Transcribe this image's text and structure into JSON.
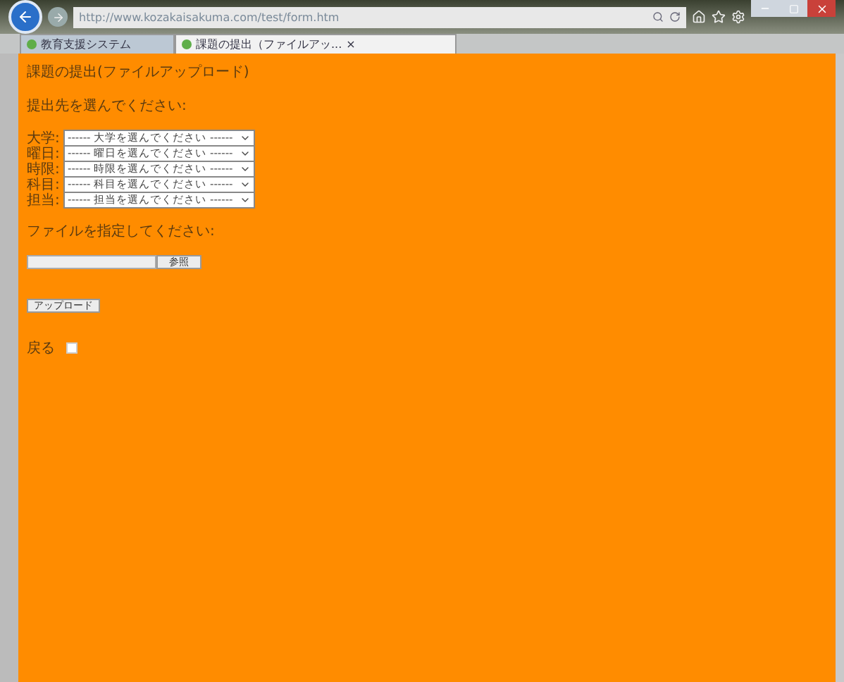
{
  "browser": {
    "url": "http://www.kozakaisakuma.com/test/form.htm",
    "tabs": [
      {
        "label": "教育支援システム",
        "selected": false,
        "closable": false
      },
      {
        "label": "課題の提出（ファイルアッ...",
        "selected": true,
        "closable": true
      }
    ],
    "close_glyph": "×"
  },
  "page": {
    "title": "課題の提出(ファイルアップロード)",
    "select_prompt": "提出先を選んでください:",
    "selects": [
      {
        "label": "大学:",
        "value": "------ 大学を選んでください ------"
      },
      {
        "label": "曜日:",
        "value": "------ 曜日を選んでください ------"
      },
      {
        "label": "時限:",
        "value": "------ 時限を選んでください ------"
      },
      {
        "label": "科目:",
        "value": "------ 科目を選んでください ------"
      },
      {
        "label": "担当:",
        "value": "------ 担当を選んでください ------"
      }
    ],
    "file_prompt": "ファイルを指定してください:",
    "browse_button": "参照",
    "upload_button": "アップロード",
    "back": {
      "label": "戻る",
      "checked": false
    }
  }
}
